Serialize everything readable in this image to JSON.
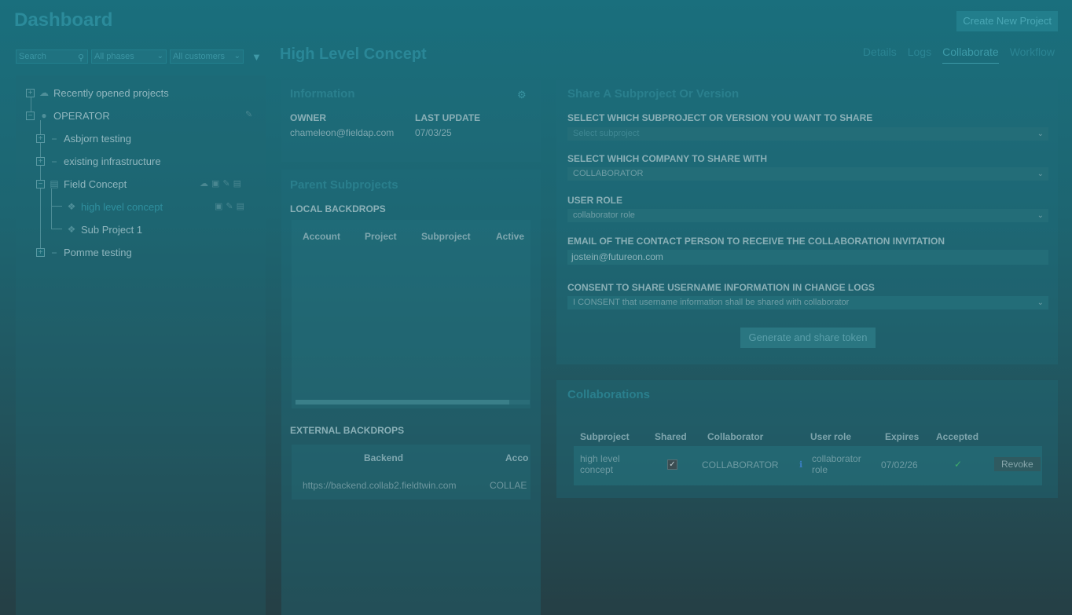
{
  "header": {
    "title": "Dashboard",
    "create_button": "Create New Project"
  },
  "filters": {
    "search_placeholder": "Search",
    "phases": "All phases",
    "customers": "All customers"
  },
  "tree": {
    "items": [
      {
        "label": "Recently opened projects"
      },
      {
        "label": "OPERATOR"
      },
      {
        "label": "Asbjorn testing"
      },
      {
        "label": "existing infrastructure"
      },
      {
        "label": "Field Concept"
      },
      {
        "label": "high level concept"
      },
      {
        "label": "Sub Project 1"
      },
      {
        "label": "Pomme testing"
      }
    ]
  },
  "main": {
    "title": "High Level Concept",
    "tabs": [
      "Details",
      "Logs",
      "Collaborate",
      "Workflow"
    ],
    "active_tab": "Collaborate"
  },
  "information": {
    "title": "Information",
    "owner_label": "OWNER",
    "owner_value": "chameleon@fieldap.com",
    "update_label": "LAST UPDATE",
    "update_value": "07/03/25"
  },
  "parent": {
    "title": "Parent Subprojects",
    "local_label": "LOCAL BACKDROPS",
    "local_columns": [
      "Account",
      "Project",
      "Subproject",
      "Active"
    ],
    "external_label": "EXTERNAL BACKDROPS",
    "external_columns": [
      "Backend",
      "Acco"
    ],
    "external_row": [
      "https://backend.collab2.fieldtwin.com",
      "COLLAE"
    ]
  },
  "share": {
    "title": "Share A Subproject Or Version",
    "subproject_label": "SELECT WHICH SUBPROJECT OR VERSION YOU WANT TO SHARE",
    "subproject_value": "Select subproject",
    "company_label": "SELECT WHICH COMPANY TO SHARE WITH",
    "company_value": "COLLABORATOR",
    "role_label": "USER ROLE",
    "role_value": "collaborator role",
    "email_label": "EMAIL OF THE CONTACT PERSON TO RECEIVE THE COLLABORATION INVITATION",
    "email_value": "jostein@futureon.com",
    "consent_label": "CONSENT TO SHARE USERNAME INFORMATION IN CHANGE LOGS",
    "consent_value": "I CONSENT that username information shall be shared with collaborator",
    "generate_button": "Generate and share token"
  },
  "collaborations": {
    "title": "Collaborations",
    "columns": [
      "Subproject",
      "Shared",
      "Collaborator",
      "User role",
      "Expires",
      "Accepted"
    ],
    "row": {
      "subproject": "high level concept",
      "collaborator": "COLLABORATOR",
      "role": "collaborator role",
      "expires": "07/02/26",
      "revoke": "Revoke"
    }
  }
}
